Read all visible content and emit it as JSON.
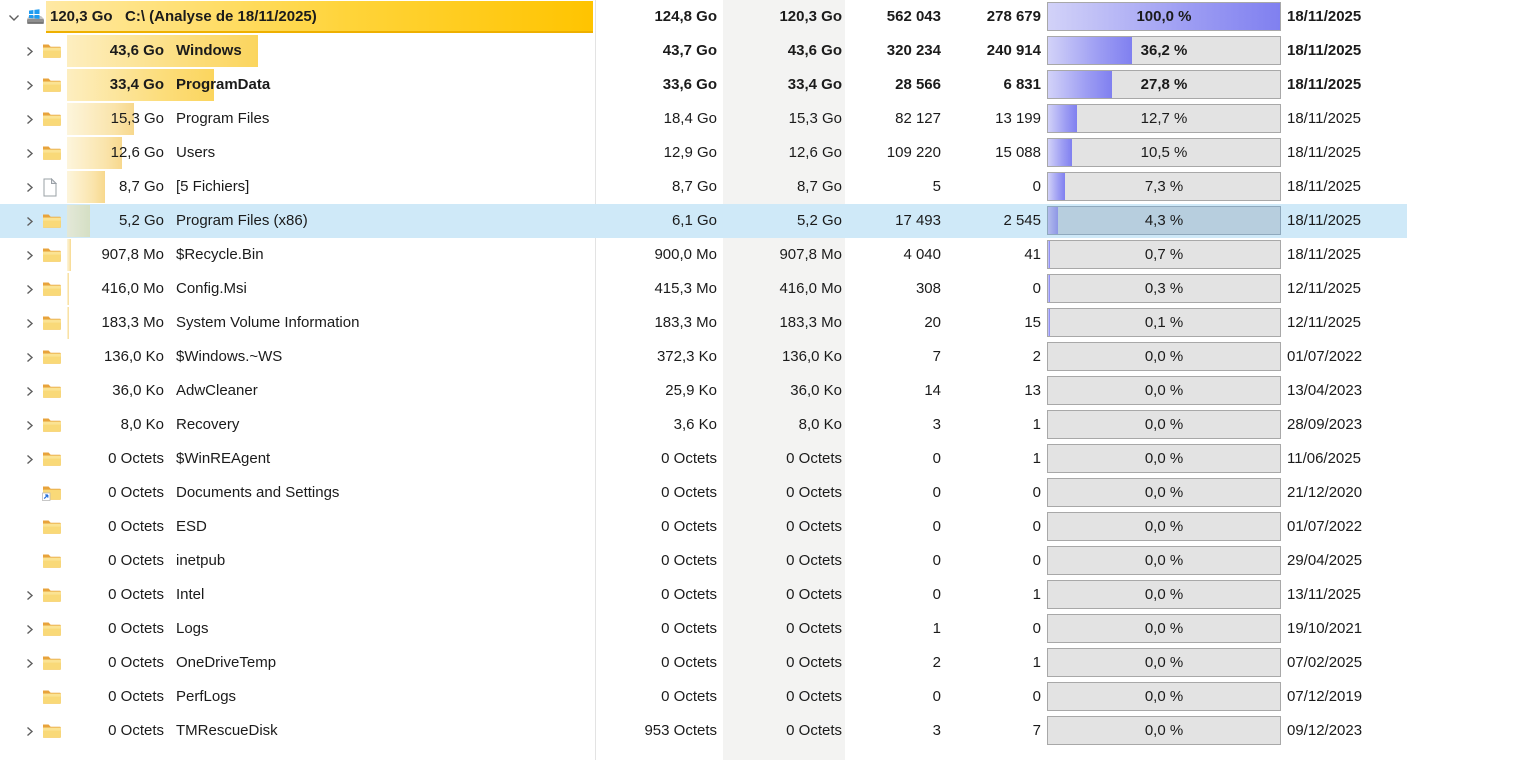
{
  "app": {
    "description": "Disk usage tree list (TreeSize-style) for drive C:, French locale"
  },
  "colors": {
    "root_bar_gold": "#ffc400",
    "child_bar_yellow": "#f7d88d",
    "percent_fill_violet": "#8080f0",
    "percent_track_gray": "#e3e3e3",
    "selection_blue": "#cfe9f8",
    "size_column_band": "#f3f3f2"
  },
  "rows": [
    {
      "level": 0,
      "icon": "drive",
      "expander": "expanded",
      "bold": true,
      "selected": false,
      "size_label": "120,3 Go",
      "name": "C:\\  (Analyse de 18/11/2025)",
      "allocated": "124,8 Go",
      "size": "120,3 Go",
      "files": "562 043",
      "folders": "278 679",
      "percent_label": "100,0 %",
      "percent": 100.0,
      "date": "18/11/2025"
    },
    {
      "level": 1,
      "icon": "folder",
      "expander": "collapsed",
      "bold": true,
      "selected": false,
      "size_label": "43,6 Go",
      "name": "Windows",
      "allocated": "43,7 Go",
      "size": "43,6 Go",
      "files": "320 234",
      "folders": "240 914",
      "percent_label": "36,2 %",
      "percent": 36.2,
      "date": "18/11/2025"
    },
    {
      "level": 1,
      "icon": "folder",
      "expander": "collapsed",
      "bold": true,
      "selected": false,
      "size_label": "33,4 Go",
      "name": "ProgramData",
      "allocated": "33,6 Go",
      "size": "33,4 Go",
      "files": "28 566",
      "folders": "6 831",
      "percent_label": "27,8 %",
      "percent": 27.8,
      "date": "18/11/2025"
    },
    {
      "level": 1,
      "icon": "folder",
      "expander": "collapsed",
      "bold": false,
      "selected": false,
      "size_label": "15,3 Go",
      "name": "Program Files",
      "allocated": "18,4 Go",
      "size": "15,3 Go",
      "files": "82 127",
      "folders": "13 199",
      "percent_label": "12,7 %",
      "percent": 12.7,
      "date": "18/11/2025"
    },
    {
      "level": 1,
      "icon": "folder",
      "expander": "collapsed",
      "bold": false,
      "selected": false,
      "size_label": "12,6 Go",
      "name": "Users",
      "allocated": "12,9 Go",
      "size": "12,6 Go",
      "files": "109 220",
      "folders": "15 088",
      "percent_label": "10,5 %",
      "percent": 10.5,
      "date": "18/11/2025"
    },
    {
      "level": 1,
      "icon": "file",
      "expander": "collapsed",
      "bold": false,
      "selected": false,
      "size_label": "8,7 Go",
      "name": "[5 Fichiers]",
      "allocated": "8,7 Go",
      "size": "8,7 Go",
      "files": "5",
      "folders": "0",
      "percent_label": "7,3 %",
      "percent": 7.3,
      "date": "18/11/2025"
    },
    {
      "level": 1,
      "icon": "folder",
      "expander": "collapsed",
      "bold": false,
      "selected": true,
      "size_label": "5,2 Go",
      "name": "Program Files (x86)",
      "allocated": "6,1 Go",
      "size": "5,2 Go",
      "files": "17 493",
      "folders": "2 545",
      "percent_label": "4,3 %",
      "percent": 4.3,
      "date": "18/11/2025"
    },
    {
      "level": 1,
      "icon": "folder",
      "expander": "collapsed",
      "bold": false,
      "selected": false,
      "size_label": "907,8 Mo",
      "name": "$Recycle.Bin",
      "allocated": "900,0 Mo",
      "size": "907,8 Mo",
      "files": "4 040",
      "folders": "41",
      "percent_label": "0,7 %",
      "percent": 0.7,
      "date": "18/11/2025"
    },
    {
      "level": 1,
      "icon": "folder",
      "expander": "collapsed",
      "bold": false,
      "selected": false,
      "size_label": "416,0 Mo",
      "name": "Config.Msi",
      "allocated": "415,3 Mo",
      "size": "416,0 Mo",
      "files": "308",
      "folders": "0",
      "percent_label": "0,3 %",
      "percent": 0.3,
      "date": "12/11/2025"
    },
    {
      "level": 1,
      "icon": "folder",
      "expander": "collapsed",
      "bold": false,
      "selected": false,
      "size_label": "183,3 Mo",
      "name": "System Volume Information",
      "allocated": "183,3 Mo",
      "size": "183,3 Mo",
      "files": "20",
      "folders": "15",
      "percent_label": "0,1 %",
      "percent": 0.1,
      "date": "12/11/2025"
    },
    {
      "level": 1,
      "icon": "folder",
      "expander": "collapsed",
      "bold": false,
      "selected": false,
      "size_label": "136,0 Ko",
      "name": "$Windows.~WS",
      "allocated": "372,3 Ko",
      "size": "136,0 Ko",
      "files": "7",
      "folders": "2",
      "percent_label": "0,0 %",
      "percent": 0,
      "date": "01/07/2022"
    },
    {
      "level": 1,
      "icon": "folder",
      "expander": "collapsed",
      "bold": false,
      "selected": false,
      "size_label": "36,0 Ko",
      "name": "AdwCleaner",
      "allocated": "25,9 Ko",
      "size": "36,0 Ko",
      "files": "14",
      "folders": "13",
      "percent_label": "0,0 %",
      "percent": 0,
      "date": "13/04/2023"
    },
    {
      "level": 1,
      "icon": "folder",
      "expander": "collapsed",
      "bold": false,
      "selected": false,
      "size_label": "8,0 Ko",
      "name": "Recovery",
      "allocated": "3,6 Ko",
      "size": "8,0 Ko",
      "files": "3",
      "folders": "1",
      "percent_label": "0,0 %",
      "percent": 0,
      "date": "28/09/2023"
    },
    {
      "level": 1,
      "icon": "folder",
      "expander": "collapsed",
      "bold": false,
      "selected": false,
      "size_label": "0 Octets",
      "name": "$WinREAgent",
      "allocated": "0 Octets",
      "size": "0 Octets",
      "files": "0",
      "folders": "1",
      "percent_label": "0,0 %",
      "percent": 0,
      "date": "11/06/2025"
    },
    {
      "level": 1,
      "icon": "folder-link",
      "expander": "none",
      "bold": false,
      "selected": false,
      "size_label": "0 Octets",
      "name": "Documents and Settings",
      "allocated": "0 Octets",
      "size": "0 Octets",
      "files": "0",
      "folders": "0",
      "percent_label": "0,0 %",
      "percent": 0,
      "date": "21/12/2020"
    },
    {
      "level": 1,
      "icon": "folder",
      "expander": "none",
      "bold": false,
      "selected": false,
      "size_label": "0 Octets",
      "name": "ESD",
      "allocated": "0 Octets",
      "size": "0 Octets",
      "files": "0",
      "folders": "0",
      "percent_label": "0,0 %",
      "percent": 0,
      "date": "01/07/2022"
    },
    {
      "level": 1,
      "icon": "folder",
      "expander": "none",
      "bold": false,
      "selected": false,
      "size_label": "0 Octets",
      "name": "inetpub",
      "allocated": "0 Octets",
      "size": "0 Octets",
      "files": "0",
      "folders": "0",
      "percent_label": "0,0 %",
      "percent": 0,
      "date": "29/04/2025"
    },
    {
      "level": 1,
      "icon": "folder",
      "expander": "collapsed",
      "bold": false,
      "selected": false,
      "size_label": "0 Octets",
      "name": "Intel",
      "allocated": "0 Octets",
      "size": "0 Octets",
      "files": "0",
      "folders": "1",
      "percent_label": "0,0 %",
      "percent": 0,
      "date": "13/11/2025"
    },
    {
      "level": 1,
      "icon": "folder",
      "expander": "collapsed",
      "bold": false,
      "selected": false,
      "size_label": "0 Octets",
      "name": "Logs",
      "allocated": "0 Octets",
      "size": "0 Octets",
      "files": "1",
      "folders": "0",
      "percent_label": "0,0 %",
      "percent": 0,
      "date": "19/10/2021"
    },
    {
      "level": 1,
      "icon": "folder",
      "expander": "collapsed",
      "bold": false,
      "selected": false,
      "size_label": "0 Octets",
      "name": "OneDriveTemp",
      "allocated": "0 Octets",
      "size": "0 Octets",
      "files": "2",
      "folders": "1",
      "percent_label": "0,0 %",
      "percent": 0,
      "date": "07/02/2025"
    },
    {
      "level": 1,
      "icon": "folder",
      "expander": "none",
      "bold": false,
      "selected": false,
      "size_label": "0 Octets",
      "name": "PerfLogs",
      "allocated": "0 Octets",
      "size": "0 Octets",
      "files": "0",
      "folders": "0",
      "percent_label": "0,0 %",
      "percent": 0,
      "date": "07/12/2019"
    },
    {
      "level": 1,
      "icon": "folder",
      "expander": "collapsed",
      "bold": false,
      "selected": false,
      "size_label": "0 Octets",
      "name": "TMRescueDisk",
      "allocated": "953 Octets",
      "size": "0 Octets",
      "files": "3",
      "folders": "7",
      "percent_label": "0,0 %",
      "percent": 0,
      "date": "09/12/2023"
    }
  ]
}
